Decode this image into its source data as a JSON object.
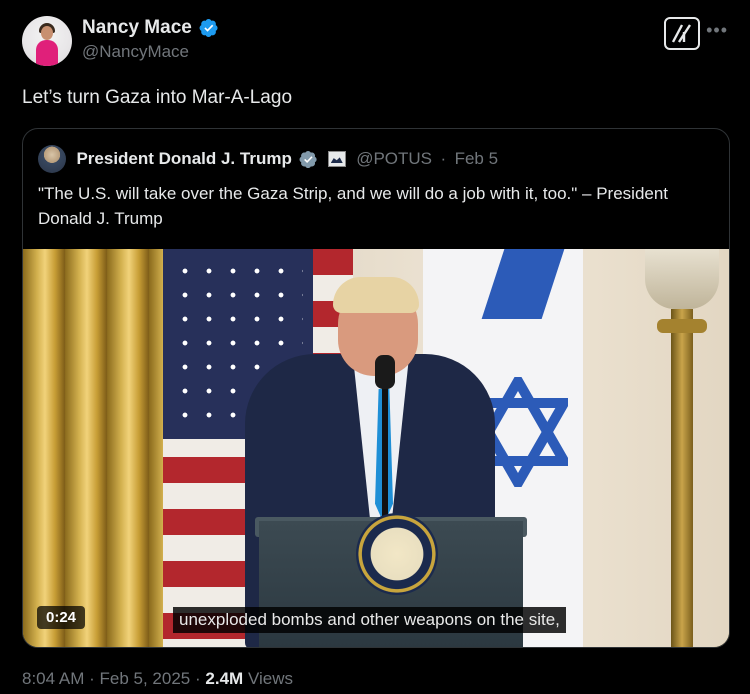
{
  "author": {
    "display_name": "Nancy Mace",
    "handle": "@NancyMace",
    "verified": true
  },
  "post": {
    "text": "Let’s turn Gaza into Mar-A-Lago"
  },
  "quoted_post": {
    "display_name": "President Donald J. Trump",
    "handle": "@POTUS",
    "separator": "·",
    "date": "Feb 5",
    "verified": true,
    "text": "\"The U.S. will take over the Gaza Strip, and we will do a job with it, too.\" – President Donald J. Trump",
    "video": {
      "duration": "0:24",
      "caption": "unexploded bombs and other weapons on the site,"
    }
  },
  "meta": {
    "time": "8:04 AM",
    "separator": "·",
    "date": "Feb 5, 2025",
    "views_count": "2.4M",
    "views_label": "Views"
  },
  "icons": {
    "more": "more-icon",
    "grok": "grok-icon",
    "verified": "verified-badge-icon"
  },
  "colors": {
    "background": "#000000",
    "text": "#e7e9ea",
    "secondary_text": "#71767b",
    "verified_blue": "#1d9bf0",
    "border": "#2f3336"
  }
}
